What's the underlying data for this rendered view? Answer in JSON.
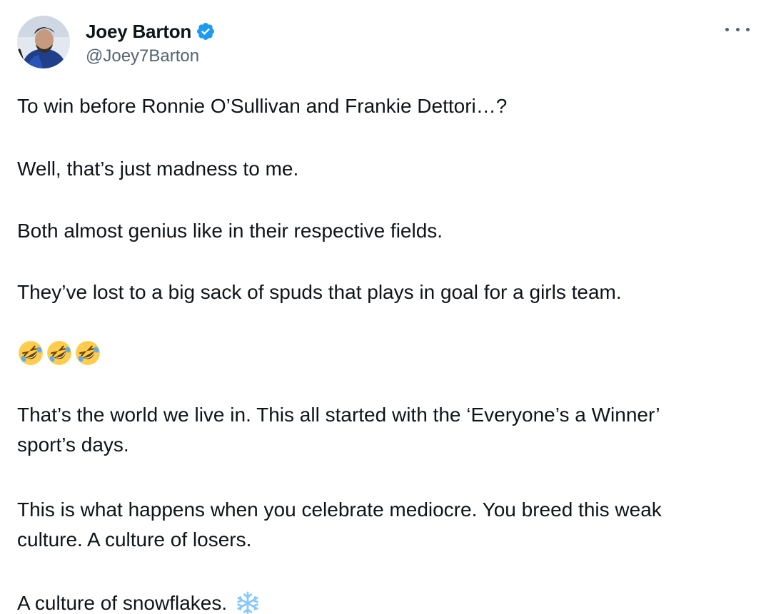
{
  "author": {
    "display_name": "Joey Barton",
    "handle": "@Joey7Barton",
    "verified": true,
    "avatar_icon": "user-avatar-photo",
    "verified_icon": "verified-badge-icon",
    "accent_color": "#1d9bf0"
  },
  "menu": {
    "icon": "more-options-icon"
  },
  "post": {
    "p1": "To win before Ronnie O’Sullivan and Frankie Dettori…?",
    "p2": "Well, that’s just madness to me.",
    "p3": "Both almost genius like in their respective fields.",
    "p4": "They’ve lost to a big sack of spuds that plays in goal for a girls team.",
    "emojis": [
      "rolling-on-floor-laughing-emoji",
      "rolling-on-floor-laughing-emoji",
      "rolling-on-floor-laughing-emoji"
    ],
    "p6_line1": "That’s the world we live in. This all started with the ‘Everyone’s a Winner’",
    "p6_line2": "sport’s days.",
    "p7_line1": "This is what happens when you celebrate mediocre. You breed this weak",
    "p7_line2": "culture. A culture of losers.",
    "p8": "A culture of snowflakes.",
    "snowflake_emoji": "snowflake-emoji"
  }
}
